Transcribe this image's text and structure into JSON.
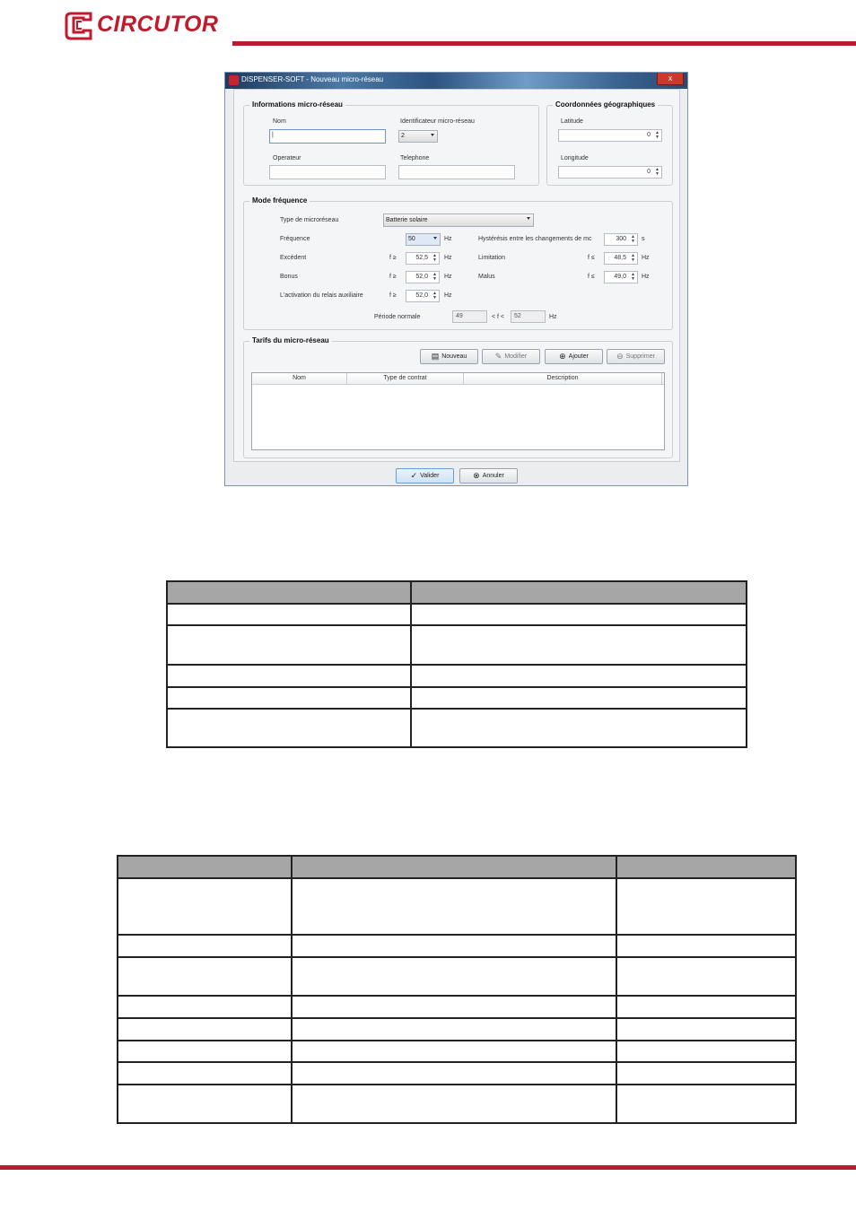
{
  "brand": {
    "name": "CIRCUTOR"
  },
  "window": {
    "title": "DISPENSER-SOFT - Nouveau micro-réseau",
    "close_label": "x"
  },
  "info": {
    "title": "Informations micro-réseau",
    "nom_label": "Nom",
    "nom_value": "|",
    "identificateur_label": "Identificateur micro-réseau",
    "identificateur_value": "2",
    "operateur_label": "Operateur",
    "telephone_label": "Telephone"
  },
  "coords": {
    "title": "Coordonnées géographiques",
    "latitude_label": "Latitude",
    "latitude_value": "0",
    "longitude_label": "Longitude",
    "longitude_value": "0"
  },
  "mode": {
    "title": "Mode fréquence",
    "type_label": "Type de microréseau",
    "type_value": "Batterie solaire",
    "frequence_label": "Fréquence",
    "frequence_value": "50",
    "hz": "Hz",
    "hysteresis_label": "Hystérésis entre les changements de mc",
    "hysteresis_value": "300",
    "hysteresis_unit": "s",
    "excedent_label": "Excédent",
    "excedent_op": "f ≥",
    "excedent_value": "52,5",
    "limitation_label": "Limitation",
    "limitation_op": "f ≤",
    "limitation_value": "48,5",
    "bonus_label": "Bonus",
    "bonus_op": "f ≥",
    "bonus_value": "52,0",
    "malus_label": "Malus",
    "malus_op": "f ≤",
    "malus_value": "49,0",
    "activation_label": "L'activation du relais auxiliaire",
    "activation_op": "f ≥",
    "activation_value": "52,0",
    "periode_label": "Période normale",
    "periode_min": "49",
    "periode_mid": "< f <",
    "periode_max": "52"
  },
  "tarifs": {
    "title": "Tarifs du micro-réseau",
    "buttons": {
      "nouveau": "Nouveau",
      "modifier": "Modifier",
      "ajouter": "Ajouter",
      "supprimer": "Supprimer"
    },
    "columns": [
      "Nom",
      "Type de contrat",
      "Description"
    ]
  },
  "footer_buttons": {
    "valider": "Valider",
    "annuler": "Annuler"
  }
}
